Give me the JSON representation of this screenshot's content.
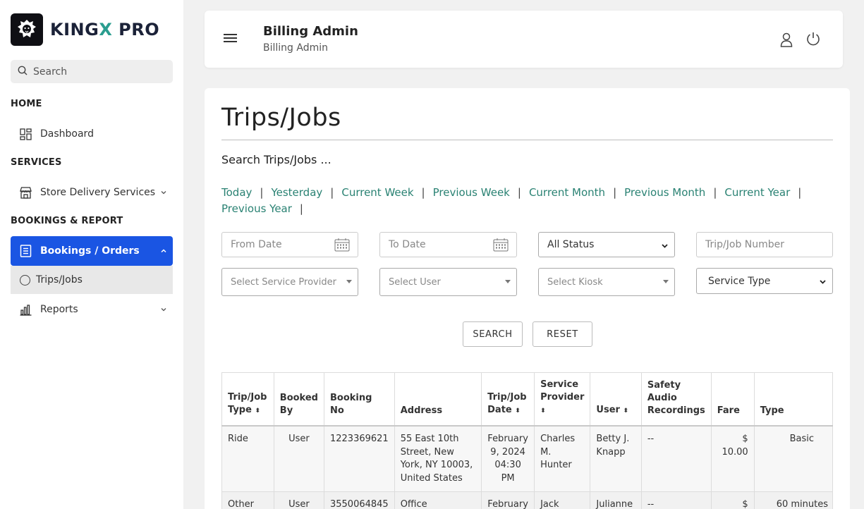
{
  "brand": {
    "name_a": "KING",
    "name_x": "X",
    "name_b": " PRO"
  },
  "sidebar": {
    "search_placeholder": "Search",
    "sections": {
      "home": "HOME",
      "services": "SERVICES",
      "bookings": "BOOKINGS & REPORT"
    },
    "items": {
      "dashboard": "Dashboard",
      "store_delivery": "Store Delivery Services",
      "bookings_orders": "Bookings / Orders",
      "trips_jobs": "Trips/Jobs",
      "reports": "Reports"
    }
  },
  "header": {
    "title": "Billing Admin",
    "subtitle": "Billing Admin"
  },
  "main": {
    "title": "Trips/Jobs",
    "search_heading": "Search Trips/Jobs ...",
    "quick_links": [
      "Today",
      "Yesterday",
      "Current Week",
      "Previous Week",
      "Current Month",
      "Previous Month",
      "Current Year",
      "Previous Year"
    ],
    "filters": {
      "from_date": "From Date",
      "to_date": "To Date",
      "status": "All Status",
      "trip_number": "Trip/Job Number",
      "service_provider": "Select Service Provider",
      "user": "Select User",
      "kiosk": "Select Kiosk",
      "service_type": "Service Type"
    },
    "buttons": {
      "search": "SEARCH",
      "reset": "RESET"
    },
    "table": {
      "headers": {
        "type_a": "Trip/Job",
        "type_b": "Type",
        "booked_a": "Booked",
        "booked_b": "By",
        "booking_no": "Booking No",
        "address": "Address",
        "date_a": "Trip/Job",
        "date_b": "Date",
        "sp_a": "Service",
        "sp_b": "Provider",
        "user": "User",
        "safety_a": "Safety",
        "safety_b": "Audio",
        "safety_c": "Recordings",
        "fare": "Fare",
        "type": "Type"
      },
      "rows": [
        {
          "job_type": "Ride",
          "booked_by": "User",
          "booking_no": "1223369621",
          "address": "55 East 10th Street, New York, NY 10003, United States",
          "date": "February 9, 2024 04:30 PM",
          "provider": "Charles M. Hunter",
          "user": "Betty J. Knapp",
          "safety": "--",
          "fare": "$ 10.00",
          "type": "Basic"
        },
        {
          "job_type": "Other",
          "booked_by": "User",
          "booking_no": "3550064845",
          "address": "Office",
          "date": "February",
          "provider": "Jack",
          "user": "Julianne",
          "safety": "--",
          "fare": "$",
          "type": "60 minutes"
        }
      ]
    }
  }
}
